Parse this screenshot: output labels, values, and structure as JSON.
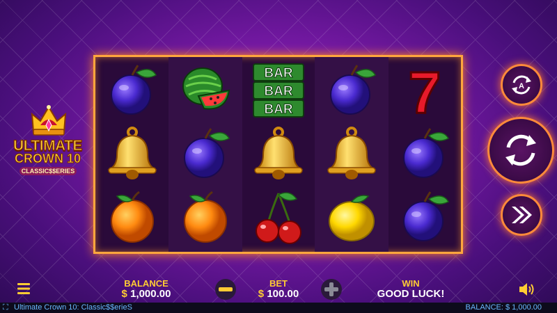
{
  "logo": {
    "line1": "ULTIMATE",
    "line2": "CROWN 10",
    "line3": "CLASSIC$$ERIES"
  },
  "reels": [
    [
      "plum-icon",
      "bell-icon",
      "orange-icon"
    ],
    [
      "watermelon-icon",
      "plum-icon",
      "orange-icon"
    ],
    [
      "bar-bar-bar-icon",
      "bell-icon",
      "cherry-icon"
    ],
    [
      "plum-icon",
      "bell-icon",
      "lemon-icon"
    ],
    [
      "seven-icon",
      "plum-icon",
      "plum-icon"
    ]
  ],
  "bar_text": "BAR",
  "seven_text": "7",
  "bottom": {
    "balance_label": "BALANCE",
    "balance_currency": "$",
    "balance_value": "1,000.00",
    "bet_label": "BET",
    "bet_currency": "$",
    "bet_value": "100.00",
    "win_label": "WIN",
    "win_value": "GOOD LUCK!"
  },
  "footer": {
    "title": "Ultimate Crown 10: Classic$$erieS",
    "balance": "BALANCE: $ 1,000.00"
  },
  "colors": {
    "frame": "#ffa63d",
    "accent": "#ffcc33"
  }
}
